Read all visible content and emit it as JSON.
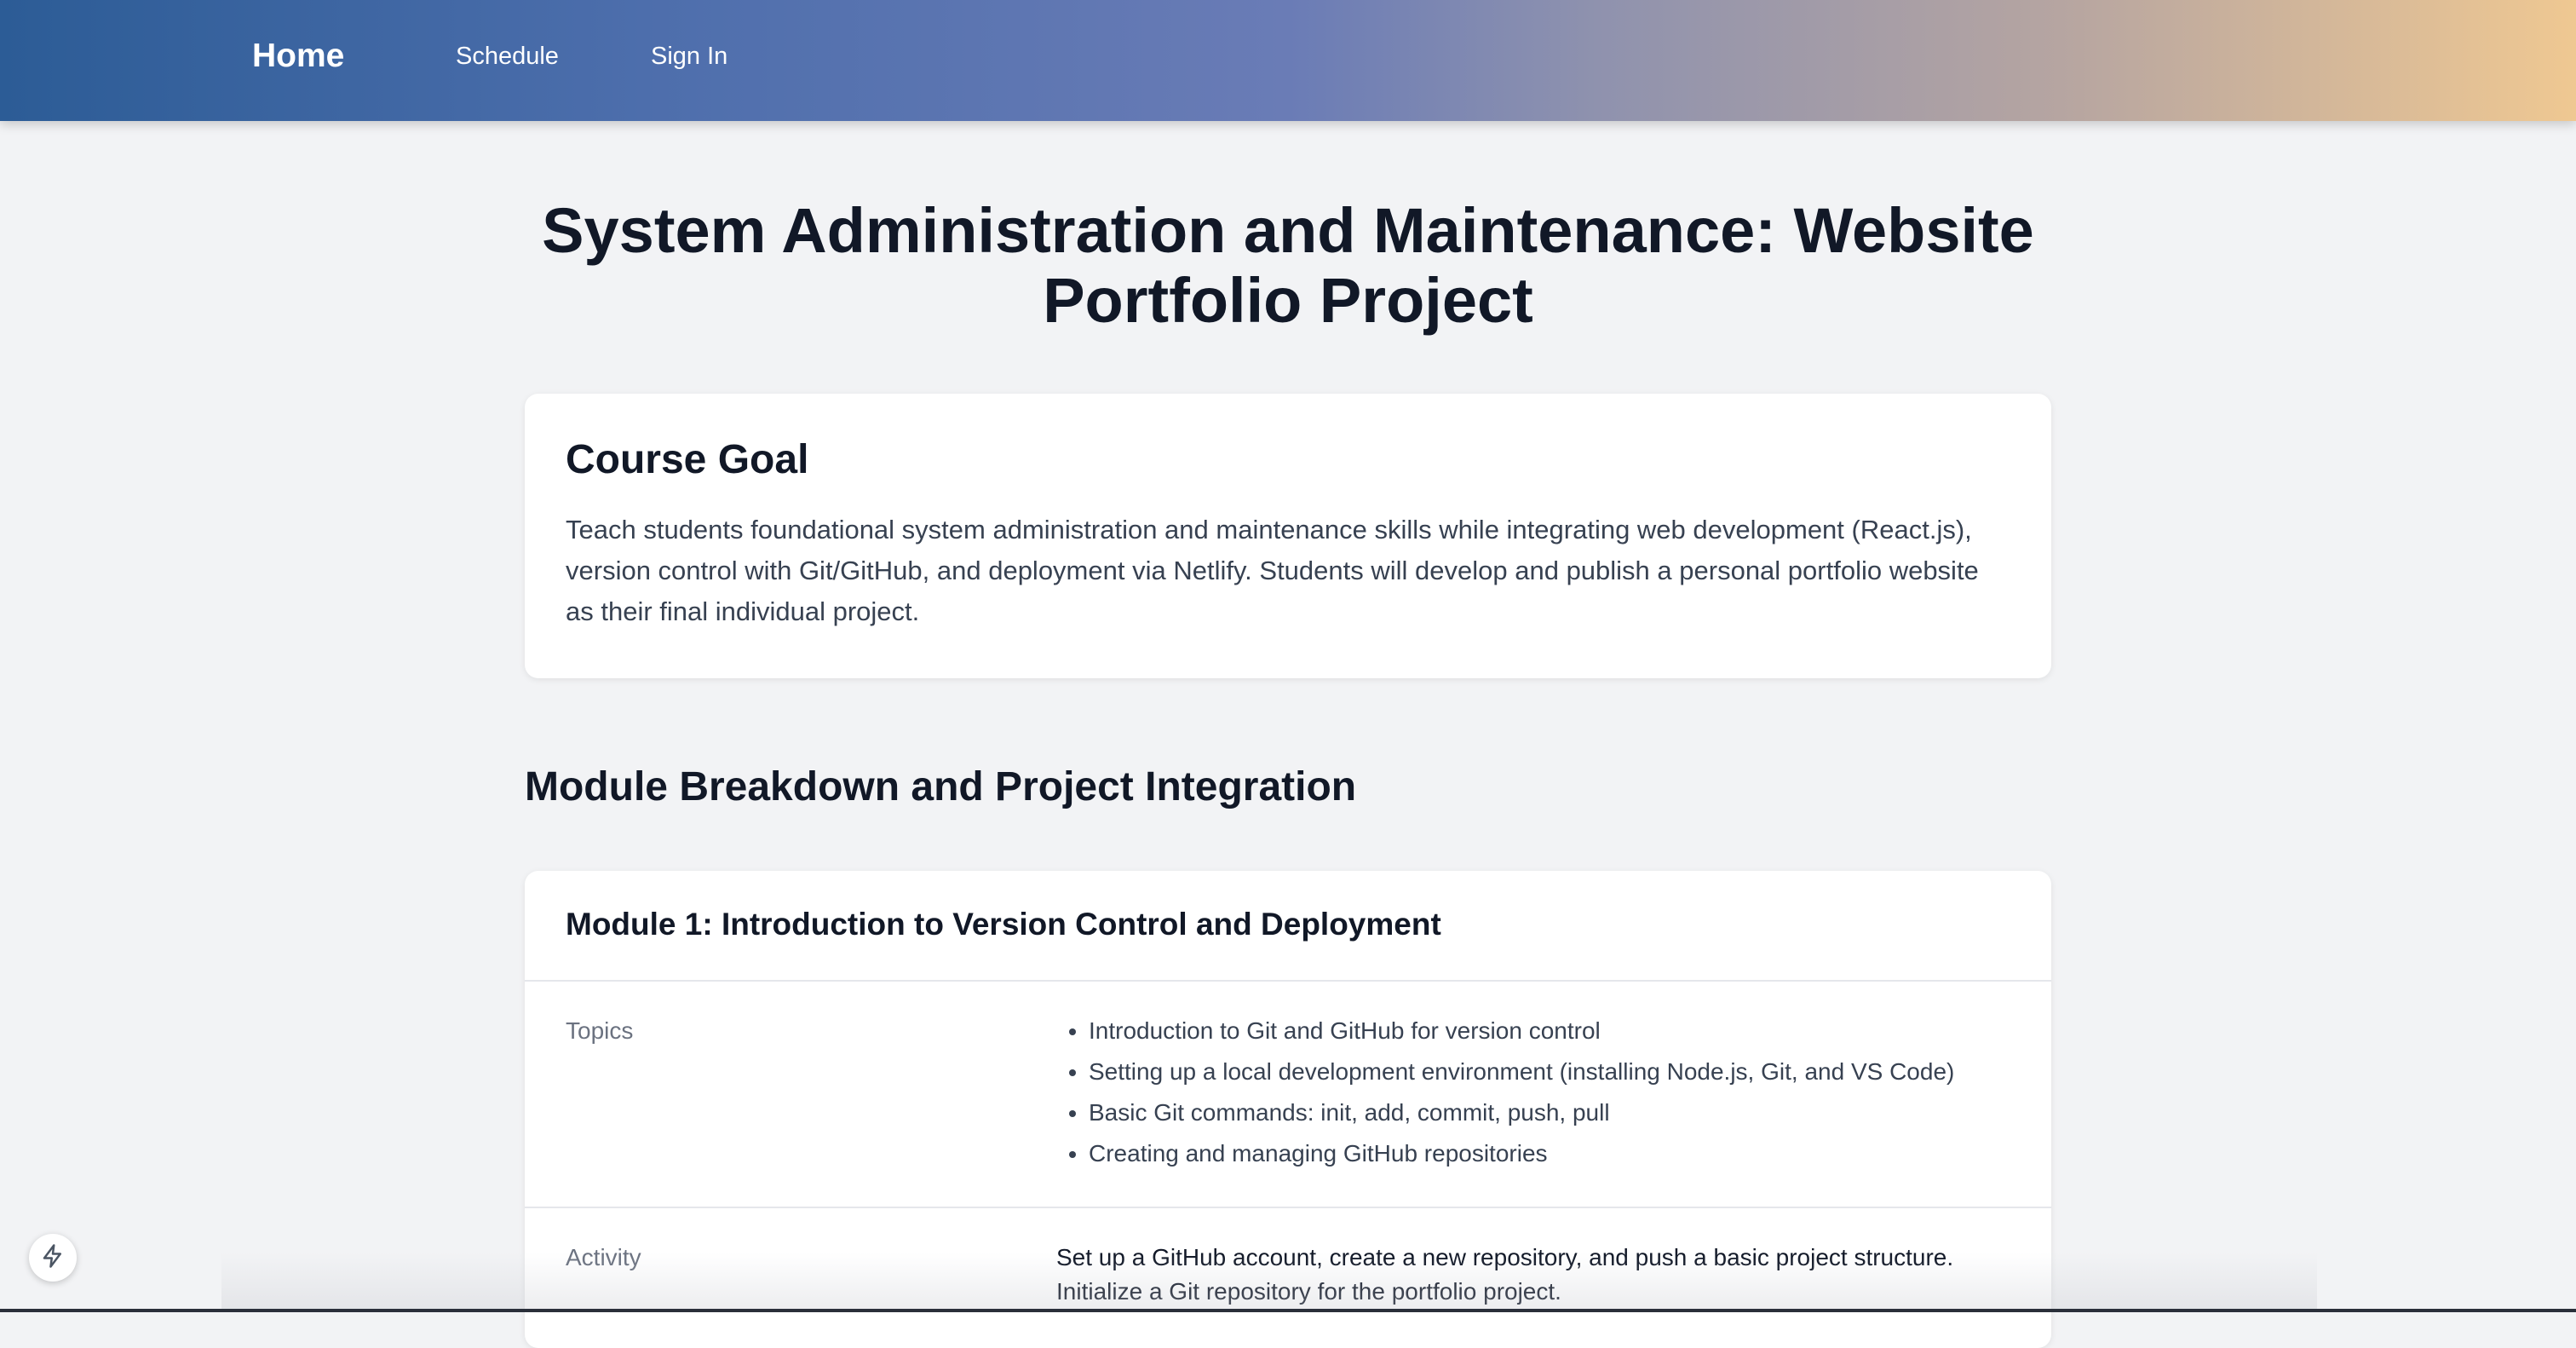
{
  "nav": {
    "brand": "Home",
    "links": [
      "Schedule",
      "Sign In"
    ]
  },
  "page_title": "System Administration and Maintenance: Website Portfolio Project",
  "course_goal": {
    "heading": "Course Goal",
    "text": "Teach students foundational system administration and maintenance skills while integrating web development (React.js), version control with Git/GitHub, and deployment via Netlify. Students will develop and publish a personal portfolio website as their final individual project."
  },
  "modules_section": {
    "heading": "Module Breakdown and Project Integration",
    "modules": [
      {
        "title": "Module 1: Introduction to Version Control and Deployment",
        "topics_label": "Topics",
        "topics": [
          "Introduction to Git and GitHub for version control",
          "Setting up a local development environment (installing Node.js, Git, and VS Code)",
          "Basic Git commands: init, add, commit, push, pull",
          "Creating and managing GitHub repositories"
        ],
        "activity_label": "Activity",
        "activity": "Set up a GitHub account, create a new repository, and push a basic project structure. Initialize a Git repository for the portfolio project."
      }
    ]
  },
  "floating_button": {
    "icon": "lightning-bolt-icon"
  }
}
